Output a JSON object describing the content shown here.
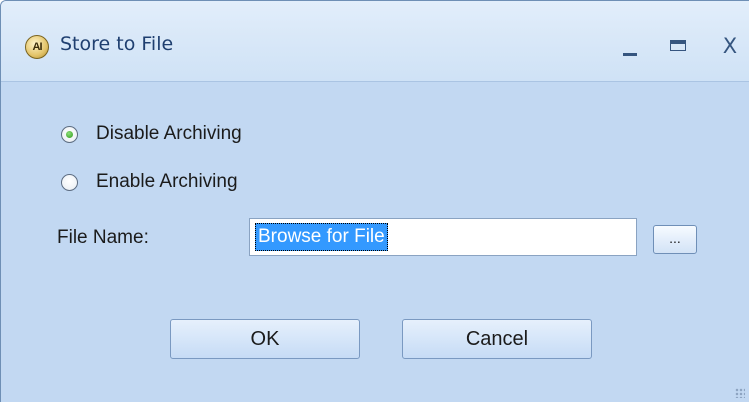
{
  "window": {
    "title": "Store to File",
    "icon": "app-logo-icon",
    "icon_text": "AI",
    "controls": {
      "minimize_icon": "minimize-icon",
      "maximize_icon": "maximize-icon",
      "close_label": "X"
    }
  },
  "options": {
    "disable_label": "Disable Archiving",
    "enable_label": "Enable Archiving",
    "selected": "disable"
  },
  "file": {
    "label": "File Name:",
    "value": "Browse for File",
    "browse_label": "..."
  },
  "buttons": {
    "ok_label": "OK",
    "cancel_label": "Cancel"
  },
  "colors": {
    "body": "#c2d8f2",
    "titlebar": "#d9e8f8",
    "selection": "#3399ff",
    "radio_dot": "#2f9a1c"
  }
}
